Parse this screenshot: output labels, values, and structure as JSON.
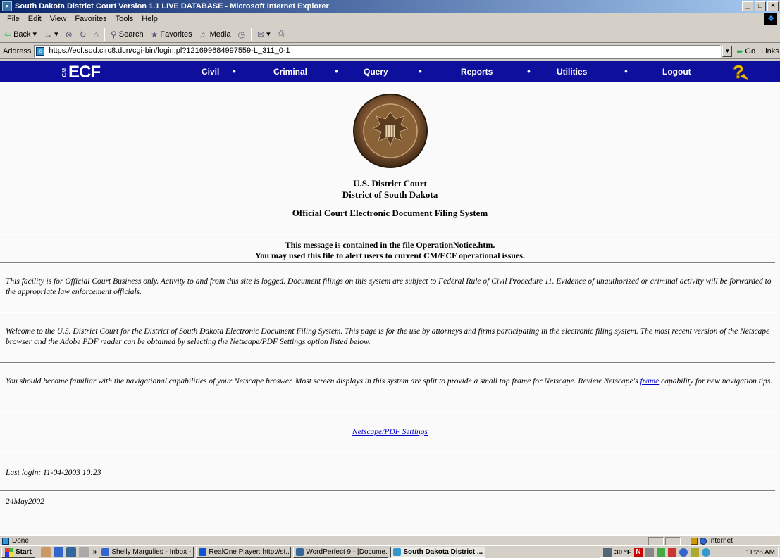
{
  "window": {
    "title": "South Dakota District Court Version 1.1 LIVE DATABASE - Microsoft Internet Explorer",
    "controls": [
      "_",
      "□",
      "×"
    ]
  },
  "menu": [
    "File",
    "Edit",
    "View",
    "Favorites",
    "Tools",
    "Help"
  ],
  "toolbar": {
    "back": "Back",
    "forward": "→",
    "search": "Search",
    "favorites": "Favorites",
    "media": "Media"
  },
  "address": {
    "label": "Address",
    "url": "https://ecf.sdd.circ8.dcn/cgi-bin/login.pl?121699684997559-L_311_0-1",
    "go": "Go",
    "links": "Links"
  },
  "nav": {
    "logo_cm": "CM",
    "logo_ecf": "ECF",
    "items": [
      "Civil",
      "Criminal",
      "Query",
      "Reports",
      "Utilities",
      "Logout"
    ],
    "dot": "•"
  },
  "colors": {
    "nav_bg": "#0f0f9e",
    "link": "#0000cc"
  },
  "page": {
    "court_line1": "U.S. District Court",
    "court_line2": "District of South Dakota",
    "system_title": "Official Court Electronic Document Filing System",
    "notice_line1": "This message is contained in the file OperationNotice.htm.",
    "notice_line2": "You may used this file to alert users to current CM/ECF operational issues.",
    "para_facility": "This facility is for Official Court Business only. Activity to and from this site is logged. Document filings on this system are subject to Federal Rule of Civil Procedure 11. Evidence of unauthorized or criminal activity will be forwarded to the appropriate law enforcement officials.",
    "para_welcome": "Welcome to the U.S. District Court for the District of South Dakota Electronic Document Filing System. This page is for the use by attorneys and firms participating in the electronic filing system. The most recent version of the Netscape browser and the Adobe PDF reader can be obtained by selecting the Netscape/PDF Settings option listed below.",
    "para_nav_before": "You should become familiar with the navigational capabilities of your Netscape broswer. Most screen displays in this system are split to provide a small top frame for Netscape. Review Netscape's ",
    "para_nav_link": "frame",
    "para_nav_after": " capability for new navigation tips.",
    "settings_link": "Netscape/PDF Settings",
    "last_login": "Last login: 11-04-2003 10:23",
    "version_date": "24May2002"
  },
  "status": {
    "text": "Done",
    "zone": "Internet"
  },
  "taskbar": {
    "start": "Start",
    "chevron": "»",
    "tasks": [
      {
        "label": "Shelly Margulies - Inbox - ...",
        "active": false
      },
      {
        "label": "RealOne Player: http://st...",
        "active": false
      },
      {
        "label": "WordPerfect 9 - [Docume...",
        "active": false
      },
      {
        "label": "South Dakota District ...",
        "active": true
      }
    ],
    "temperature": "30 °F",
    "clock": "11:26 AM"
  }
}
